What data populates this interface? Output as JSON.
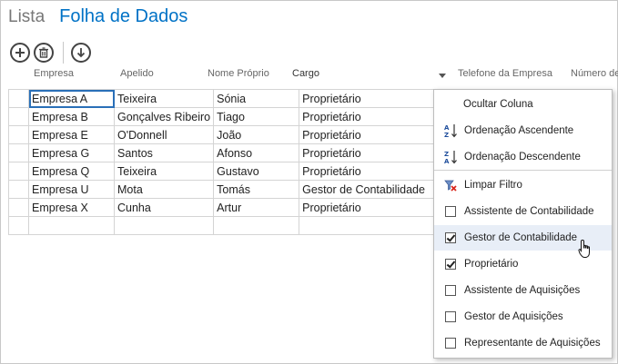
{
  "view_tabs": {
    "list": "Lista",
    "datasheet": "Folha de Dados"
  },
  "toolbar": {
    "add_icon": "plus-circle",
    "delete_icon": "trash-circle",
    "sync_icon": "down-arrow-circle"
  },
  "columns": [
    "Empresa",
    "Apelido",
    "Nome Próprio",
    "Cargo",
    "Telefone da Empresa",
    "Número de"
  ],
  "rows": [
    [
      "Empresa A",
      "Teixeira",
      "Sónia",
      "Proprietário"
    ],
    [
      "Empresa B",
      "Gonçalves Ribeiro",
      "Tiago",
      "Proprietário"
    ],
    [
      "Empresa E",
      "O'Donnell",
      "João",
      "Proprietário"
    ],
    [
      "Empresa G",
      "Santos",
      "Afonso",
      "Proprietário"
    ],
    [
      "Empresa Q",
      "Teixeira",
      "Gustavo",
      "Proprietário"
    ],
    [
      "Empresa U",
      "Mota",
      "Tomás",
      "Gestor de Contabilidade"
    ],
    [
      "Empresa X",
      "Cunha",
      "Artur",
      "Proprietário"
    ]
  ],
  "menu": {
    "hide_column": "Ocultar Coluna",
    "sort_asc": "Ordenação Ascendente",
    "sort_desc": "Ordenação Descendente",
    "clear_filter": "Limpar Filtro",
    "filters": [
      {
        "label": "Assistente de Contabilidade",
        "checked": false
      },
      {
        "label": "Gestor de Contabilidade",
        "checked": true
      },
      {
        "label": "Proprietário",
        "checked": true
      },
      {
        "label": "Assistente de Aquisições",
        "checked": false
      },
      {
        "label": "Gestor de Aquisições",
        "checked": false
      },
      {
        "label": "Representante de Aquisições",
        "checked": false
      }
    ]
  },
  "colors": {
    "accent": "#0072c6",
    "selection": "#2a70b8"
  }
}
